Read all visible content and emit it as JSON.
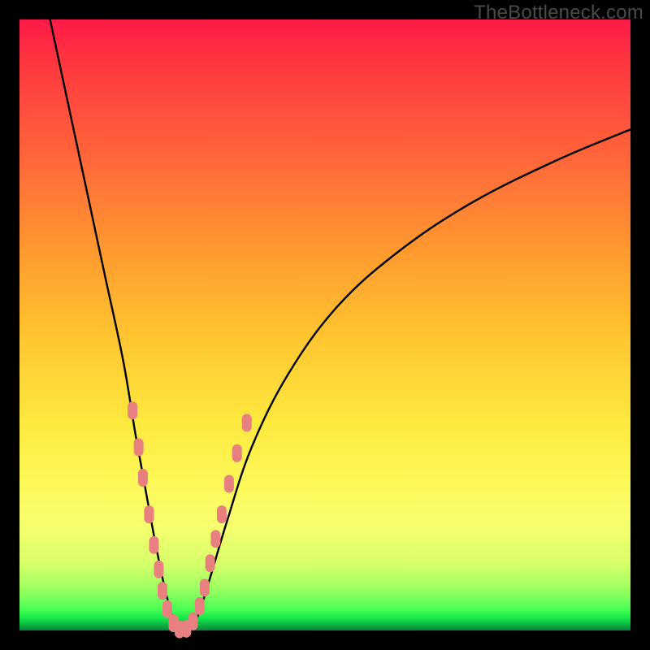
{
  "watermark": "TheBottleneck.com",
  "chart_data": {
    "type": "line",
    "title": "",
    "xlabel": "",
    "ylabel": "",
    "xlim": [
      0,
      100
    ],
    "ylim": [
      0,
      100
    ],
    "grid": false,
    "legend": false,
    "series": [
      {
        "name": "bottleneck-curve",
        "x": [
          5,
          8,
          11,
          14,
          17,
          19,
          21,
          22.5,
          24,
          25.5,
          27,
          29,
          31,
          34,
          38,
          44,
          52,
          62,
          74,
          88,
          100
        ],
        "y": [
          100,
          86,
          72,
          58,
          44,
          32,
          21,
          13,
          6,
          1,
          0,
          2,
          8,
          18,
          30,
          42,
          53,
          62,
          70,
          77,
          82
        ]
      }
    ],
    "markers": {
      "name": "highlighted-points",
      "color": "#e98080",
      "points": [
        {
          "x": 18.5,
          "y": 36
        },
        {
          "x": 19.5,
          "y": 30
        },
        {
          "x": 20.2,
          "y": 25
        },
        {
          "x": 21.2,
          "y": 19
        },
        {
          "x": 22.0,
          "y": 14
        },
        {
          "x": 22.8,
          "y": 10
        },
        {
          "x": 23.4,
          "y": 6.5
        },
        {
          "x": 24.2,
          "y": 3.5
        },
        {
          "x": 25.2,
          "y": 1.2
        },
        {
          "x": 26.2,
          "y": 0.2
        },
        {
          "x": 27.3,
          "y": 0.3
        },
        {
          "x": 28.4,
          "y": 1.5
        },
        {
          "x": 29.5,
          "y": 4
        },
        {
          "x": 30.3,
          "y": 7
        },
        {
          "x": 31.2,
          "y": 11
        },
        {
          "x": 32.1,
          "y": 15
        },
        {
          "x": 33.1,
          "y": 19
        },
        {
          "x": 34.3,
          "y": 24
        },
        {
          "x": 35.6,
          "y": 29
        },
        {
          "x": 37.2,
          "y": 34
        }
      ]
    },
    "background_gradient": {
      "top": "#ff1a47",
      "middle": "#fde93e",
      "bottom": "#08833a"
    }
  }
}
